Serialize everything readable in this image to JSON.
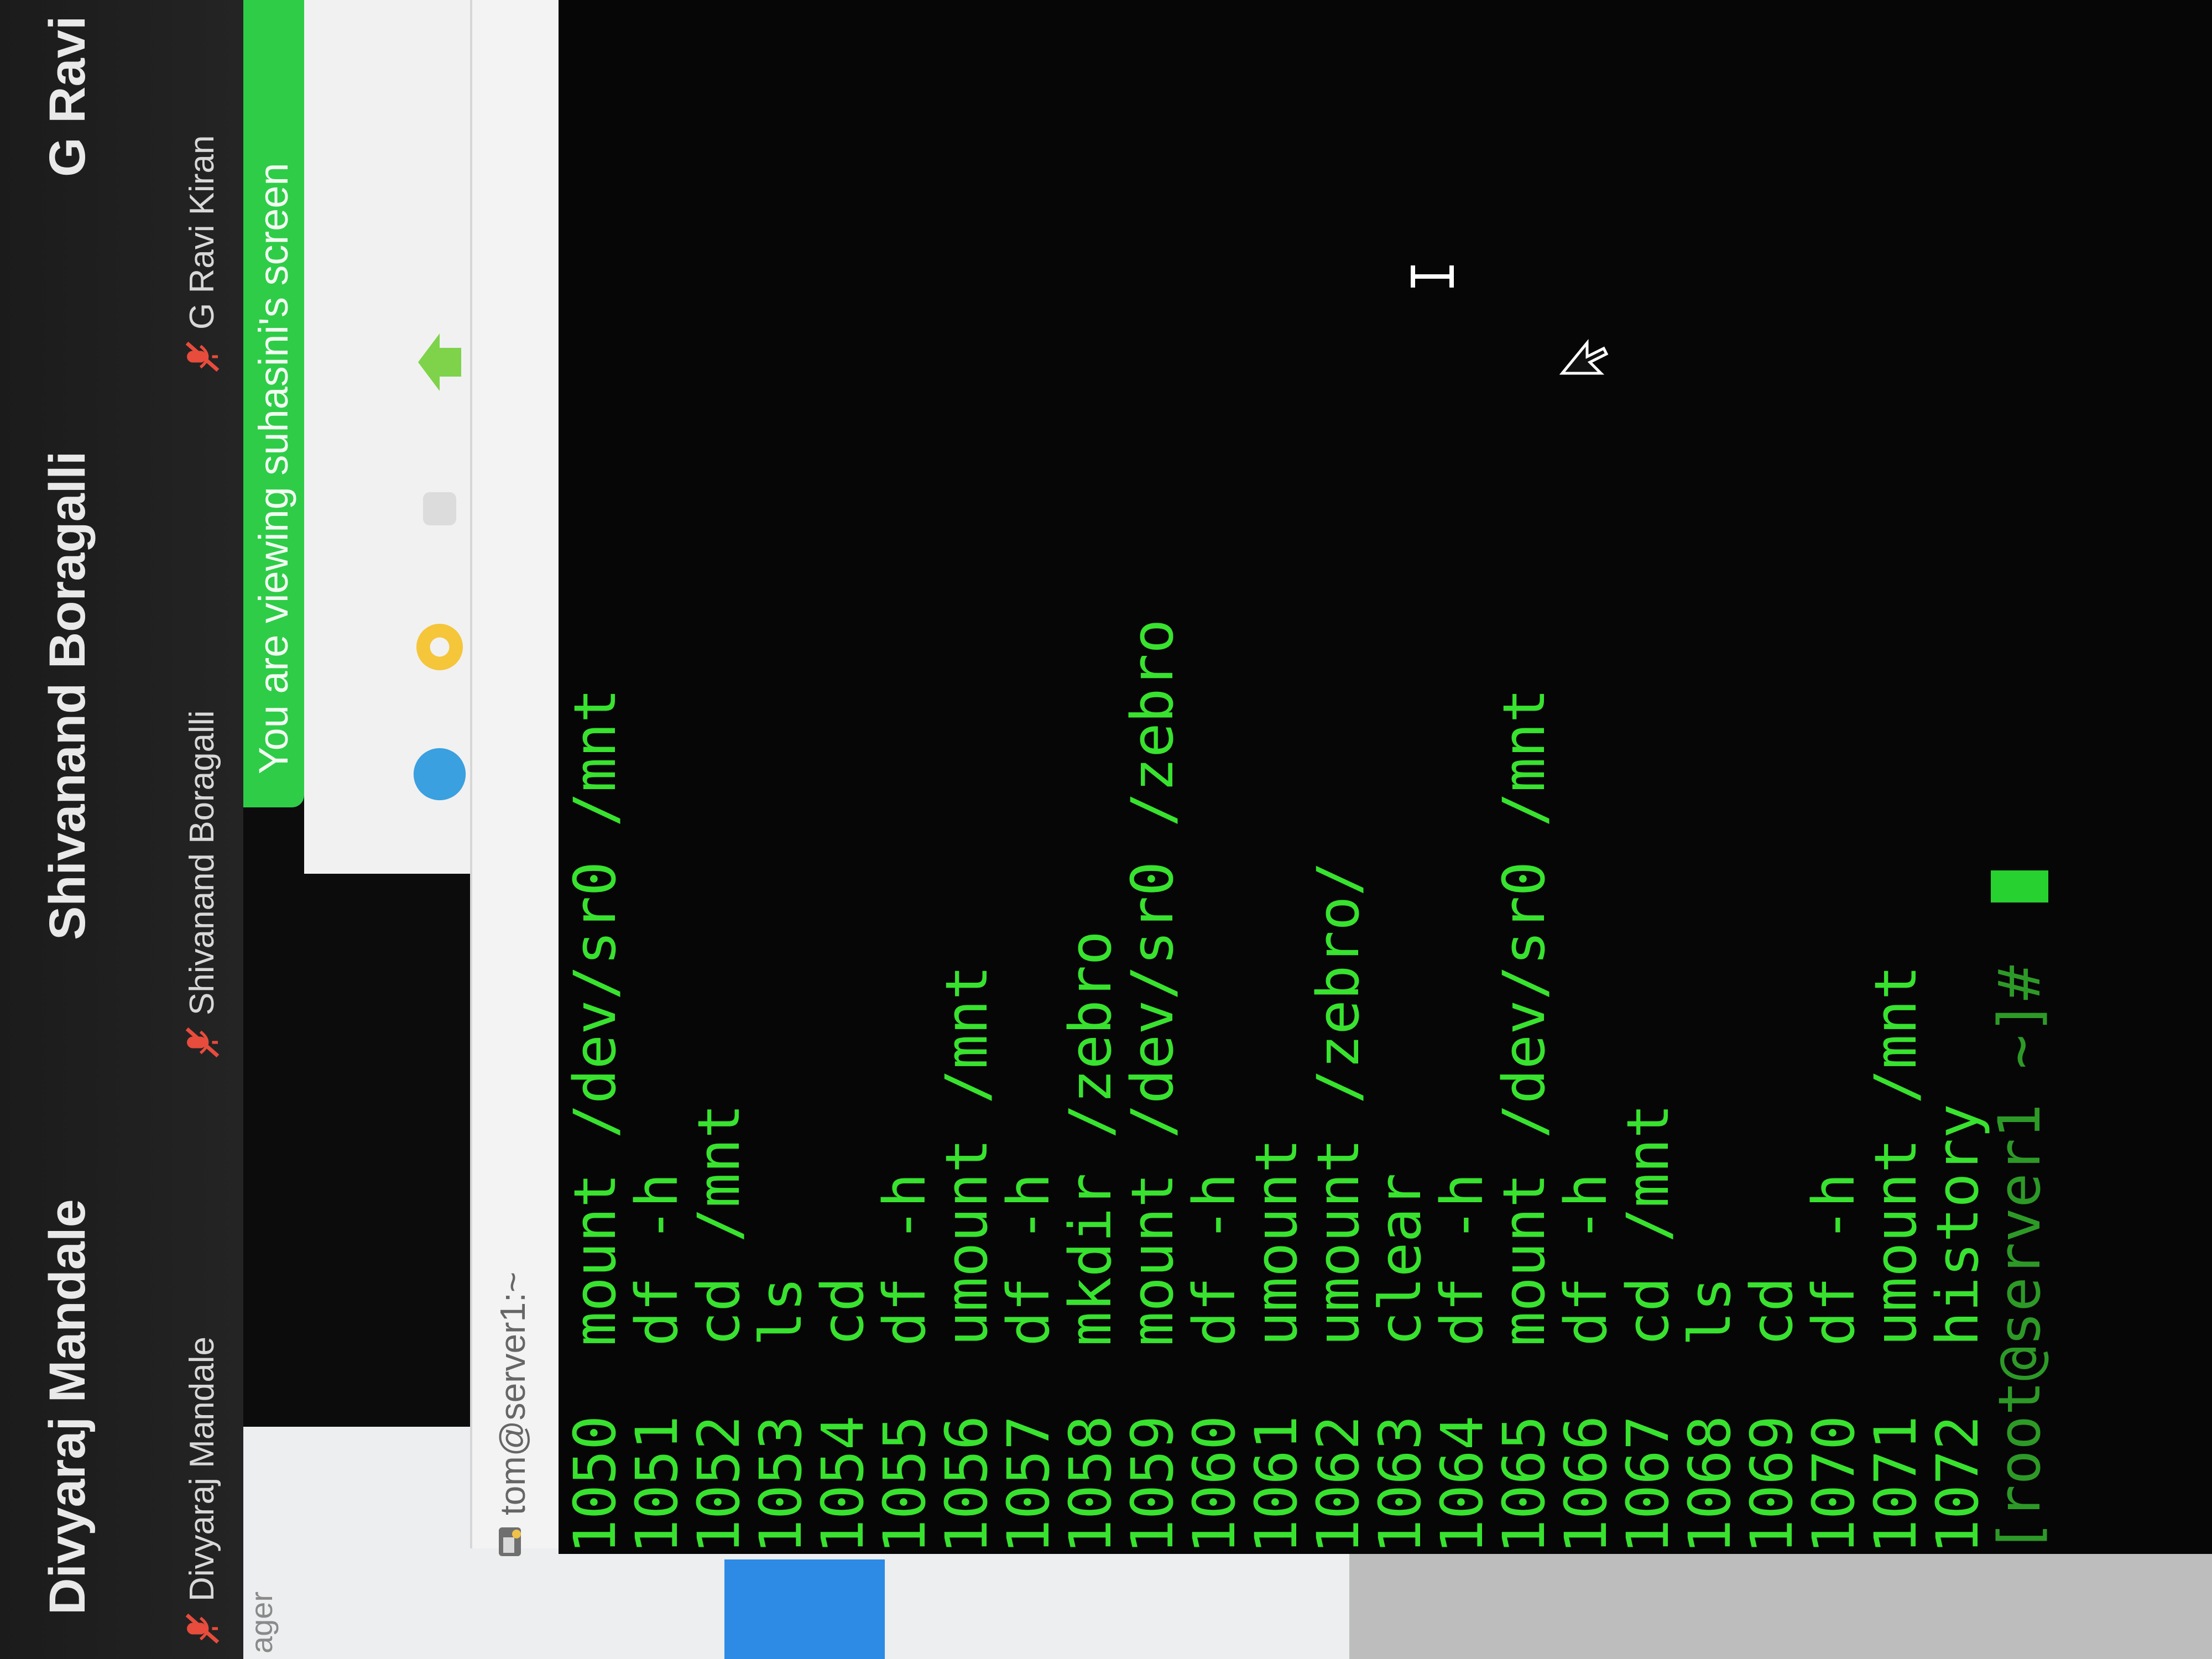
{
  "participants": {
    "tiles": [
      {
        "name": "Divyaraj Mandale",
        "label": "Divyaraj Mandale"
      },
      {
        "name": "Shivanand Boragalli",
        "label": "Shivanand Boragalli"
      },
      {
        "name": "G Ravi Kiran",
        "label": "G Ravi Kiran"
      }
    ]
  },
  "app": {
    "side_label": "ager"
  },
  "banner": {
    "text": "You are viewing suhasini's screen"
  },
  "terminal": {
    "title": "tom@server1:~",
    "history": [
      {
        "num": "1050",
        "cmd": "mount /dev/sr0 /mnt"
      },
      {
        "num": "1051",
        "cmd": "df -h"
      },
      {
        "num": "1052",
        "cmd": "cd /mnt"
      },
      {
        "num": "1053",
        "cmd": "ls"
      },
      {
        "num": "1054",
        "cmd": "cd"
      },
      {
        "num": "1055",
        "cmd": "df -h"
      },
      {
        "num": "1056",
        "cmd": "umount /mnt"
      },
      {
        "num": "1057",
        "cmd": "df -h"
      },
      {
        "num": "1058",
        "cmd": "mkdir /zebro"
      },
      {
        "num": "1059",
        "cmd": "mount /dev/sr0 /zebro"
      },
      {
        "num": "1060",
        "cmd": "df -h"
      },
      {
        "num": "1061",
        "cmd": "umount"
      },
      {
        "num": "1062",
        "cmd": "umount /zebro/"
      },
      {
        "num": "1063",
        "cmd": "clear"
      },
      {
        "num": "1064",
        "cmd": "df -h"
      },
      {
        "num": "1065",
        "cmd": "mount /dev/sr0 /mnt"
      },
      {
        "num": "1066",
        "cmd": "df -h"
      },
      {
        "num": "1067",
        "cmd": "cd /mnt"
      },
      {
        "num": "1068",
        "cmd": "ls"
      },
      {
        "num": "1069",
        "cmd": "cd"
      },
      {
        "num": "1070",
        "cmd": "df -h"
      },
      {
        "num": "1071",
        "cmd": "umount /mnt"
      },
      {
        "num": "1072",
        "cmd": "history"
      }
    ],
    "prompt": "[root@server1 ~]# ",
    "colors": {
      "text": "#38e22f",
      "background": "#060606"
    }
  },
  "icons": [
    "mic-muted-icon",
    "desktop-app-icon",
    "terminal-app-icon",
    "mouse-pointer-icon",
    "text-cursor-icon"
  ]
}
